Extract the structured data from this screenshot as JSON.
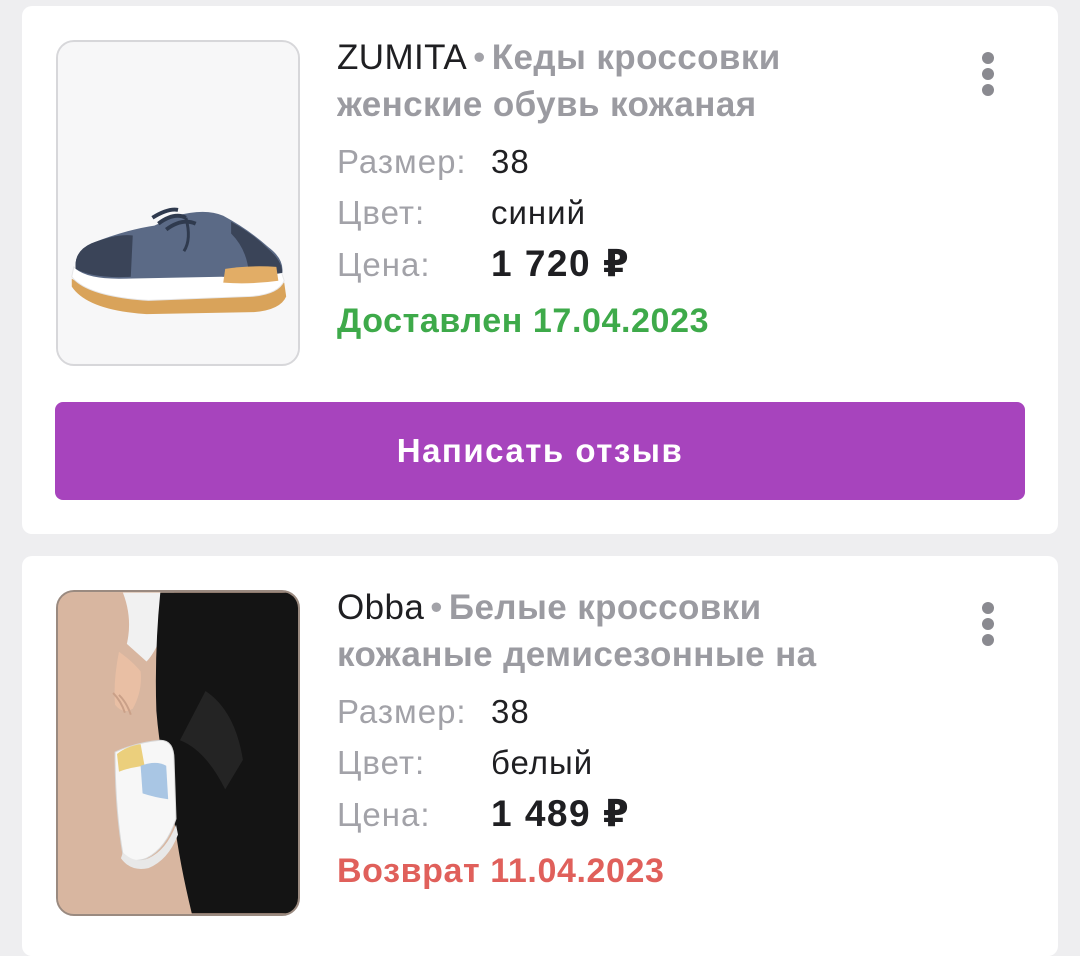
{
  "orders": [
    {
      "brand": "ZUMITA",
      "separator": "•",
      "description": "Кеды кроссовки женские обувь кожаная",
      "size_label": "Размер:",
      "size_value": "38",
      "color_label": "Цвет:",
      "color_value": "синий",
      "price_label": "Цена:",
      "price_value": "1 720 ₽",
      "status": "Доставлен 17.04.2023",
      "status_color": "#3eaa4a",
      "review_button": "Написать отзыв",
      "image_icon": "sneaker-photo",
      "menu_icon": "more-vertical-icon"
    },
    {
      "brand": "Obba",
      "separator": "•",
      "description": "Белые кроссовки кожаные демисезонные на",
      "size_label": "Размер:",
      "size_value": "38",
      "color_label": "Цвет:",
      "color_value": "белый",
      "price_label": "Цена:",
      "price_value": "1 489 ₽",
      "status": "Возврат 11.04.2023",
      "status_color": "#e0605b",
      "image_icon": "sneaker-photo",
      "menu_icon": "more-vertical-icon"
    }
  ],
  "colors": {
    "accent": "#a744bd",
    "background": "#eeeef0",
    "delivered": "#3eaa4a",
    "returned": "#e0605b"
  }
}
